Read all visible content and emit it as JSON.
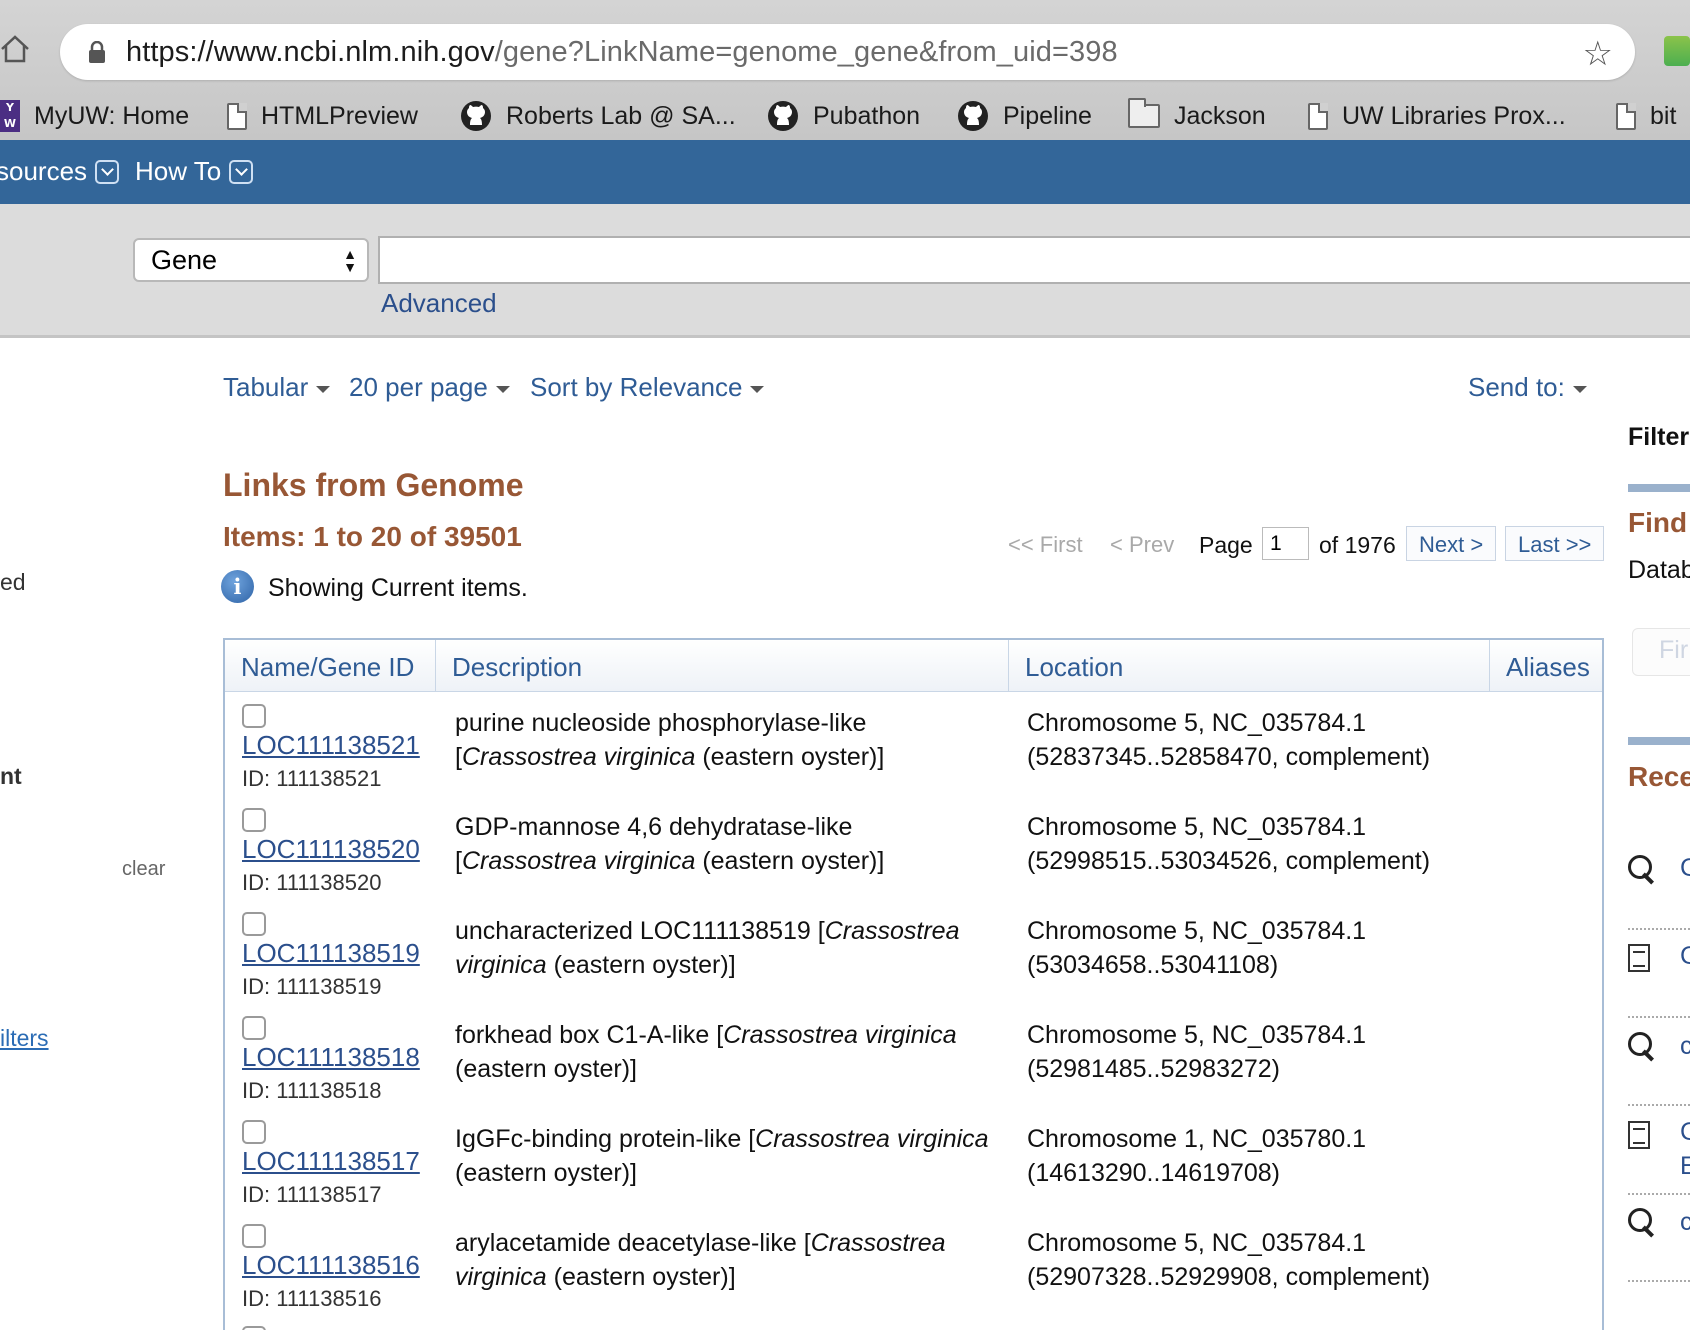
{
  "browser": {
    "url_host": "https://www.ncbi.nlm.nih.gov",
    "url_path": "/gene?LinkName=genome_gene&from_uid=398",
    "bookmarks": [
      {
        "label": "MyUW: Home",
        "icon": "uw-icon"
      },
      {
        "label": "HTMLPreview",
        "icon": "page-icon"
      },
      {
        "label": "Roberts Lab @ SA...",
        "icon": "github-icon"
      },
      {
        "label": "Pubathon",
        "icon": "github-icon"
      },
      {
        "label": "Pipeline",
        "icon": "github-icon"
      },
      {
        "label": "Jackson",
        "icon": "folder-icon"
      },
      {
        "label": "UW Libraries Prox...",
        "icon": "page-icon"
      },
      {
        "label": "bit",
        "icon": "page-icon"
      }
    ]
  },
  "nav": {
    "resources": "sources",
    "howto": "How To"
  },
  "search": {
    "database": "Gene",
    "query": "",
    "advanced": "Advanced"
  },
  "left_sidebar": {
    "frag1": "ed",
    "frag2": "nt",
    "clear": "clear",
    "filters": "ilters"
  },
  "toolbar": {
    "format": "Tabular",
    "per_page": "20 per page",
    "sort": "Sort by Relevance",
    "send_to": "Send to:"
  },
  "results": {
    "title": "Links from Genome",
    "items": "Items: 1 to 20 of 39501",
    "showing": "Showing Current items."
  },
  "pager": {
    "first": "<< First",
    "prev": "< Prev",
    "page_label": "Page",
    "page_value": "1",
    "of_pages": "of 1976",
    "next": "Next >",
    "last": "Last >>"
  },
  "table": {
    "headers": [
      "Name/Gene ID",
      "Description",
      "Location",
      "Aliases"
    ],
    "rows": [
      {
        "name": "LOC111138521",
        "id": "ID: 111138521",
        "desc_pre": "purine nucleoside phosphorylase-like [",
        "desc_species": "Crassostrea virginica",
        "desc_post": " (eastern oyster)]",
        "loc1": "Chromosome 5, NC_035784.1",
        "loc2": "(52837345..52858470, complement)"
      },
      {
        "name": "LOC111138520",
        "id": "ID: 111138520",
        "desc_pre": "GDP-mannose 4,6 dehydratase-like [",
        "desc_species": "Crassostrea virginica",
        "desc_post": " (eastern oyster)]",
        "loc1": "Chromosome 5, NC_035784.1",
        "loc2": "(52998515..53034526, complement)"
      },
      {
        "name": "LOC111138519",
        "id": "ID: 111138519",
        "desc_pre": "uncharacterized LOC111138519 [",
        "desc_species": "Crassostrea virginica",
        "desc_post": " (eastern oyster)]",
        "loc1": "Chromosome 5, NC_035784.1",
        "loc2": "(53034658..53041108)"
      },
      {
        "name": "LOC111138518",
        "id": "ID: 111138518",
        "desc_pre": "forkhead box C1-A-like [",
        "desc_species": "Crassostrea virginica",
        "desc_post": " (eastern oyster)]",
        "loc1": "Chromosome 5, NC_035784.1",
        "loc2": "(52981485..52983272)"
      },
      {
        "name": "LOC111138517",
        "id": "ID: 111138517",
        "desc_pre": "IgGFc-binding protein-like [",
        "desc_species": "Crassostrea virginica",
        "desc_post": " (eastern oyster)]",
        "loc1": "Chromosome 1, NC_035780.1",
        "loc2": "(14613290..14619708)"
      },
      {
        "name": "LOC111138516",
        "id": "ID: 111138516",
        "desc_pre": "arylacetamide deacetylase-like [",
        "desc_species": "Crassostrea virginica",
        "desc_post": " (eastern oyster)]",
        "loc1": "Chromosome 5, NC_035784.1",
        "loc2": "(52907328..52929908, complement)"
      }
    ]
  },
  "right_sidebar": {
    "filter": "Filter",
    "find": "Find",
    "database": "Datab",
    "find_button": "Fir",
    "recent": "Rece",
    "recent_items": [
      "C",
      "C",
      "c",
      "C",
      "E",
      "c"
    ]
  }
}
